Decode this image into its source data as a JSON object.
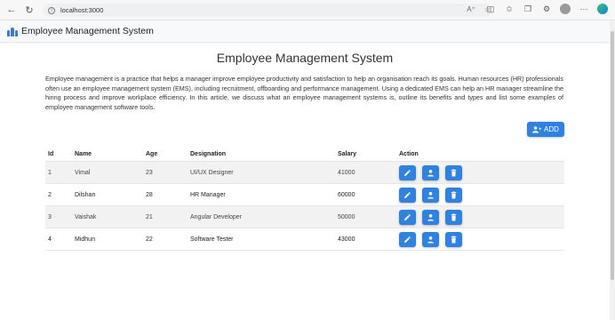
{
  "browser": {
    "url": "localhost:3000"
  },
  "navbar": {
    "brand": "Employee Management System"
  },
  "page": {
    "title": "Employee Management System",
    "intro": "Employee management is a practice that helps a manager improve employee productivity and satisfaction to help an organisation reach its goals. Human resources (HR) professionals often use an employee management system (EMS), including recruitment, offboarding and performance management. Using a dedicated EMS can help an HR manager streamline the hiring process and improve workplace efficiency. In this article, we discuss what an employee management systems is, outline its benefits and types and list some examples of employee management software tools.",
    "add_label": "ADD"
  },
  "table": {
    "headers": {
      "id": "Id",
      "name": "Name",
      "age": "Age",
      "designation": "Designation",
      "salary": "Salary",
      "action": "Action"
    },
    "rows": [
      {
        "id": "1",
        "name": "Vimal",
        "age": "23",
        "designation": "UI/UX Designer",
        "salary": "41000"
      },
      {
        "id": "2",
        "name": "Dilshan",
        "age": "28",
        "designation": "HR Manager",
        "salary": "60000"
      },
      {
        "id": "3",
        "name": "Vaishak",
        "age": "21",
        "designation": "Angular Developer",
        "salary": "50000"
      },
      {
        "id": "4",
        "name": "Midhun",
        "age": "22",
        "designation": "Software Tester",
        "salary": "43000"
      }
    ]
  },
  "colors": {
    "accent": "#2f82e0",
    "stripe": "#f2f2f2",
    "navbar": "#f8f9fa"
  },
  "icons": [
    "back-icon",
    "reload-icon",
    "info-icon",
    "read-aloud-icon",
    "favorite-icon",
    "split-screen-icon",
    "favorites-icon",
    "collections-icon",
    "profile-icon",
    "more-icon",
    "edge-icon",
    "team-icon",
    "user-plus-icon",
    "edit-icon",
    "view-user-icon",
    "delete-icon"
  ]
}
